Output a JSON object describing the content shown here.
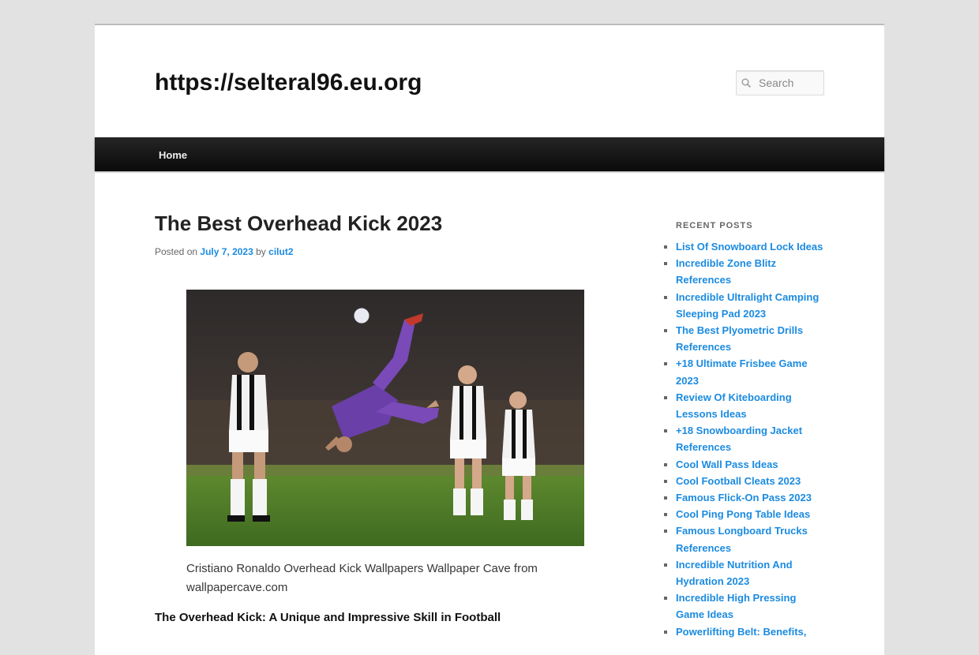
{
  "site": {
    "title": "https://selteral96.eu.org"
  },
  "search": {
    "placeholder": "Search",
    "icon": "search-icon"
  },
  "nav": {
    "home_label": "Home"
  },
  "post": {
    "title": "The Best Overhead Kick 2023",
    "posted_on": "Posted on",
    "date": "July 7, 2023",
    "by": "by",
    "author": "cilut2",
    "image_caption": "Cristiano Ronaldo Overhead Kick Wallpapers Wallpaper Cave from wallpapercave.com",
    "section_heading": "The Overhead Kick: A Unique and Impressive Skill in Football"
  },
  "sidebar": {
    "widget_title": "Recent Posts",
    "recent_posts": [
      "List Of Snowboard Lock Ideas",
      "Incredible Zone Blitz References",
      "Incredible Ultralight Camping Sleeping Pad 2023",
      "The Best Plyometric Drills References",
      "+18 Ultimate Frisbee Game 2023",
      "Review Of Kiteboarding Lessons Ideas",
      "+18 Snowboarding Jacket References",
      "Cool Wall Pass Ideas",
      "Cool Football Cleats 2023",
      "Famous Flick-On Pass 2023",
      "Cool Ping Pong Table Ideas",
      "Famous Longboard Trucks References",
      "Incredible Nutrition And Hydration 2023",
      "Incredible High Pressing Game Ideas",
      "Powerlifting Belt: Benefits,"
    ]
  },
  "colors": {
    "link": "#1b8be0",
    "nav_bg": "#1a1a1a",
    "page_bg": "#e2e2e2"
  }
}
